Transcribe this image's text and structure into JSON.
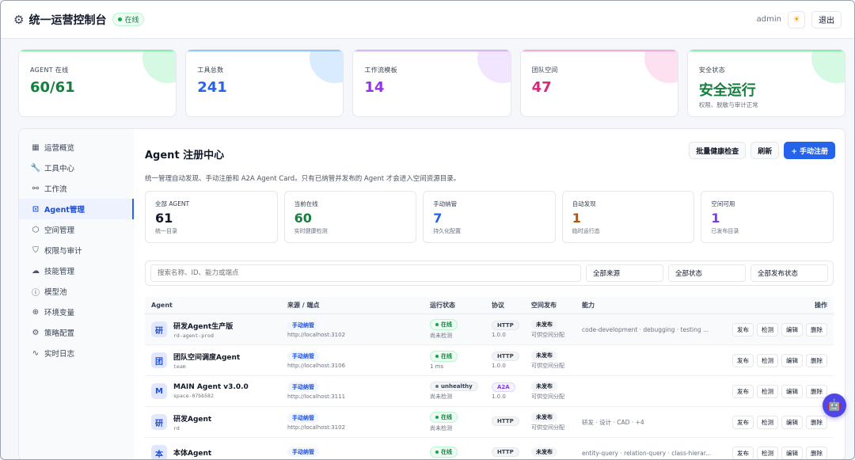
{
  "header": {
    "title": "统一运营控制台",
    "status": "在线",
    "user": "admin",
    "logout": "退出"
  },
  "stats": [
    {
      "label": "AGENT 在线",
      "value": "60/61",
      "sub": "",
      "color": "#15803d",
      "accent": "#86efac"
    },
    {
      "label": "工具总数",
      "value": "241",
      "sub": "",
      "color": "#2563eb",
      "accent": "#93c5fd"
    },
    {
      "label": "工作流模板",
      "value": "14",
      "sub": "",
      "color": "#9333ea",
      "accent": "#d8b4fe"
    },
    {
      "label": "团队空间",
      "value": "47",
      "sub": "",
      "color": "#db2777",
      "accent": "#f9a8d4"
    },
    {
      "label": "安全状态",
      "value": "安全运行",
      "sub": "权限、脱敏与审计正常",
      "color": "#15803d",
      "accent": "#86efac"
    }
  ],
  "sidebar": {
    "items": [
      {
        "label": "运营概览",
        "icon": "grid-icon"
      },
      {
        "label": "工具中心",
        "icon": "wrench-icon"
      },
      {
        "label": "工作流",
        "icon": "workflow-icon"
      },
      {
        "label": "Agent管理",
        "icon": "robot-icon"
      },
      {
        "label": "空间管理",
        "icon": "cube-icon"
      },
      {
        "label": "权限与审计",
        "icon": "shield-icon"
      },
      {
        "label": "技能管理",
        "icon": "cloud-icon"
      },
      {
        "label": "模型池",
        "icon": "info-icon"
      },
      {
        "label": "环境变量",
        "icon": "globe-icon"
      },
      {
        "label": "策略配置",
        "icon": "gear-icon"
      },
      {
        "label": "实时日志",
        "icon": "pulse-icon"
      }
    ]
  },
  "page": {
    "title": "Agent 注册中心",
    "desc": "统一管理自动发现、手动注册和 A2A Agent Card。只有已纳管并发布的 Agent 才会进入空间资源目录。",
    "actions": {
      "health": "批量健康检查",
      "refresh": "刷新",
      "register": "+ 手动注册"
    }
  },
  "mini_stats": [
    {
      "label": "全部 AGENT",
      "value": "61",
      "sub": "统一目录",
      "color": "#111827"
    },
    {
      "label": "当前在线",
      "value": "60",
      "sub": "实时健康检测",
      "color": "#15803d"
    },
    {
      "label": "手动纳管",
      "value": "7",
      "sub": "持久化配置",
      "color": "#2563eb"
    },
    {
      "label": "自动发现",
      "value": "1",
      "sub": "临时运行态",
      "color": "#b45309"
    },
    {
      "label": "空间可用",
      "value": "1",
      "sub": "已发布目录",
      "color": "#7c3aed"
    }
  ],
  "filters": {
    "search_placeholder": "搜索名称、ID、能力或端点",
    "source": "全部来源",
    "state": "全部状态",
    "publish": "全部发布状态"
  },
  "table": {
    "headers": {
      "agent": "Agent",
      "src": "来源 / 端点",
      "state": "运行状态",
      "proto": "协议",
      "pub": "空间发布",
      "cap": "能力",
      "ops": "操作"
    },
    "ops": {
      "publish": "发布",
      "check": "检测",
      "edit": "编辑",
      "delete": "删除"
    },
    "rows": [
      {
        "avatar": "研",
        "name": "研发Agent生产版",
        "id": "rd-agent-prod",
        "source": "手动纳管",
        "endpoint": "http://localhost:3102",
        "state": "在线",
        "state_sub": "尚未检测",
        "state_kind": "green",
        "proto": "HTTP",
        "proto_ver": "1.0.0",
        "proto_kind": "gray",
        "pub": "未发布",
        "pub_sub": "可供空间分配",
        "cap": "code-development · debugging · testing ..."
      },
      {
        "avatar": "团",
        "name": "团队空间调度Agent",
        "id": "team",
        "source": "手动纳管",
        "endpoint": "http://localhost:3106",
        "state": "在线",
        "state_sub": "1 ms",
        "state_kind": "green",
        "proto": "HTTP",
        "proto_ver": "1.0.0",
        "proto_kind": "gray",
        "pub": "未发布",
        "pub_sub": "可供空间分配",
        "cap": ""
      },
      {
        "avatar": "M",
        "name": "MAIN Agent v3.0.0",
        "id": "space-07bb582",
        "source": "手动纳管",
        "endpoint": "http://localhost:3111",
        "state": "unhealthy",
        "state_sub": "尚未检测",
        "state_kind": "gray",
        "proto": "A2A",
        "proto_ver": "1.0.0",
        "proto_kind": "purple",
        "pub": "未发布",
        "pub_sub": "可供空间分配",
        "cap": ""
      },
      {
        "avatar": "研",
        "name": "研发Agent",
        "id": "rd",
        "source": "手动纳管",
        "endpoint": "http://localhost:3102",
        "state": "在线",
        "state_sub": "尚未检测",
        "state_kind": "green",
        "proto": "HTTP",
        "proto_ver": "",
        "proto_kind": "gray",
        "pub": "未发布",
        "pub_sub": "可供空间分配",
        "cap": "研发 · 设计 · CAD · +4"
      },
      {
        "avatar": "本",
        "name": "本体Agent",
        "id": "",
        "source": "手动纳管",
        "endpoint": "",
        "state": "在线",
        "state_sub": "",
        "state_kind": "green",
        "proto": "HTTP",
        "proto_ver": "",
        "proto_kind": "gray",
        "pub": "未发布",
        "pub_sub": "",
        "cap": "entity-query · relation-query · class-hierar..."
      }
    ]
  }
}
